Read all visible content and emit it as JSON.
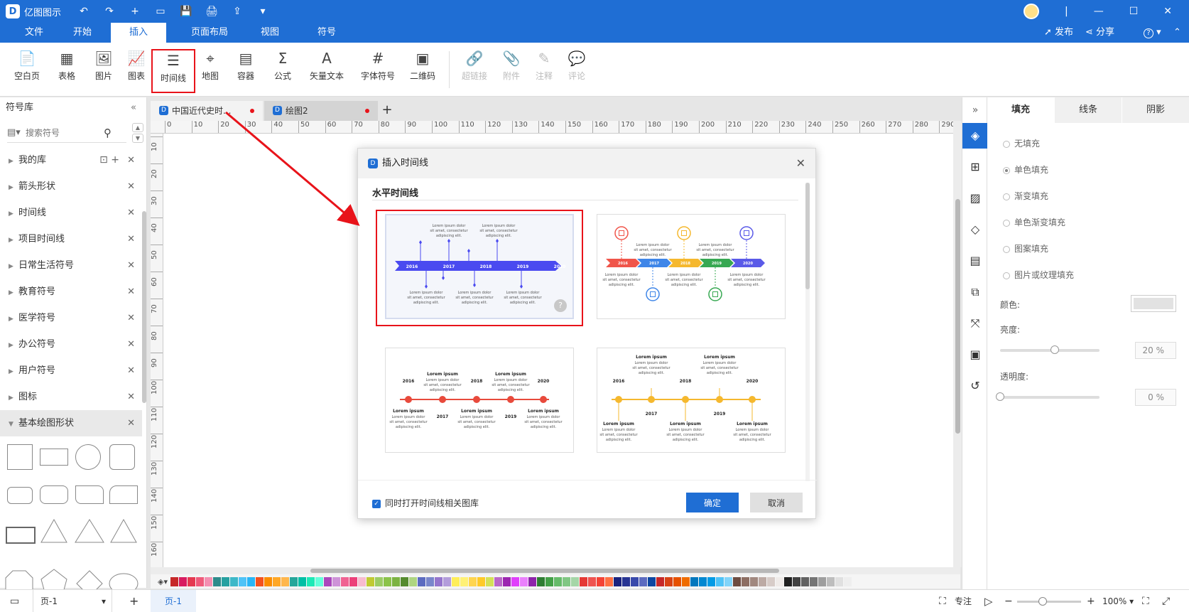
{
  "app": {
    "name": "亿图图示",
    "logo_letter": "D"
  },
  "titlebar": {
    "quick_actions": [
      "↶",
      "↷",
      "+",
      "▭",
      "💾",
      "🖨",
      "⇪",
      "▾"
    ],
    "window_controls": [
      "|",
      "—",
      "☐",
      "✕"
    ]
  },
  "menu": {
    "tabs": [
      "文件",
      "开始",
      "插入",
      "页面布局",
      "视图",
      "符号"
    ],
    "active": "插入",
    "publish": "发布",
    "share": "分享",
    "help": "?"
  },
  "ribbon": {
    "buttons": [
      {
        "label": "空白页",
        "icon": "📄"
      },
      {
        "label": "表格",
        "icon": "▦"
      },
      {
        "label": "图片",
        "icon": "🖼"
      },
      {
        "label": "图表",
        "icon": "📈"
      },
      {
        "label": "时间线",
        "icon": "☰"
      },
      {
        "label": "地图",
        "icon": "⌖"
      },
      {
        "label": "容器",
        "icon": "▤"
      },
      {
        "label": "公式",
        "icon": "Σ"
      },
      {
        "label": "矢量文本",
        "icon": "A"
      },
      {
        "label": "字体符号",
        "icon": "#"
      },
      {
        "label": "二维码",
        "icon": "▣"
      },
      {
        "label": "超链接",
        "icon": "🔗"
      },
      {
        "label": "附件",
        "icon": "📎"
      },
      {
        "label": "注释",
        "icon": "✎"
      },
      {
        "label": "评论",
        "icon": "💬"
      }
    ],
    "highlighted": "时间线"
  },
  "left_panel": {
    "title": "符号库",
    "search_placeholder": "搜索符号",
    "items": [
      {
        "label": "我的库"
      },
      {
        "label": "箭头形状"
      },
      {
        "label": "时间线"
      },
      {
        "label": "项目时间线"
      },
      {
        "label": "日常生活符号"
      },
      {
        "label": "教育符号"
      },
      {
        "label": "医学符号"
      },
      {
        "label": "办公符号"
      },
      {
        "label": "用户符号"
      },
      {
        "label": "图标"
      },
      {
        "label": "基本绘图形状"
      }
    ]
  },
  "doc_tabs": [
    {
      "label": "中国近代史时..."
    },
    {
      "label": "绘图2"
    }
  ],
  "ruler": {
    "h": [
      "0",
      "10",
      "20",
      "30",
      "40",
      "50",
      "60",
      "70",
      "80",
      "90",
      "100",
      "110",
      "120",
      "130",
      "140",
      "150",
      "160",
      "170",
      "180",
      "190",
      "200",
      "210",
      "220",
      "230",
      "240",
      "250",
      "260",
      "270",
      "280",
      "290"
    ],
    "v": [
      "10",
      "20",
      "30",
      "40",
      "50",
      "60",
      "70",
      "80",
      "90",
      "100",
      "110",
      "120",
      "130",
      "140",
      "150",
      "160"
    ]
  },
  "dialog": {
    "title": "插入时间线",
    "section": "水平时间线",
    "checkbox_label": "同时打开时间线相关图库",
    "ok": "确定",
    "cancel": "取消",
    "lorem_title": "Lorem ipsum",
    "lorem_body": [
      "Lorem ipsum dolor",
      "sit amet, consectetur",
      "adipiscing elit."
    ],
    "years": [
      "2016",
      "2017",
      "2018",
      "2019",
      "2020"
    ],
    "help": "?"
  },
  "properties": {
    "tabs": [
      "填充",
      "线条",
      "阴影"
    ],
    "fill_options": [
      "无填充",
      "单色填充",
      "渐变填充",
      "单色渐变填充",
      "图案填充",
      "图片或纹理填充"
    ],
    "selected_fill": "单色填充",
    "color_label": "颜色:",
    "brightness_label": "亮度:",
    "brightness_value": "20 %",
    "brightness_level": 0.55,
    "transparency_label": "透明度:",
    "transparency_value": "0 %",
    "transparency_level": 0.0
  },
  "statusbar": {
    "page_select": "页-1",
    "page_tab": "页-1",
    "focus": "专注",
    "zoom": "100%"
  },
  "colors": {
    "accent": "#1f6ed4",
    "highlight_red": "#e8131a",
    "timeline_blue": "#4a4af0",
    "timeline_red": "#e84a3c",
    "timeline_yellow": "#f5b82e",
    "chev": [
      "#f0554a",
      "#3f86e8",
      "#f5b82e",
      "#37a852",
      "#5a5ae8"
    ],
    "palette": [
      "#c62828",
      "#d81b60",
      "#e53950",
      "#ef5a7a",
      "#f48fb1",
      "#2e8b8b",
      "#26a0a0",
      "#3db8c8",
      "#4fc3f7",
      "#29b6f6",
      "#f4511e",
      "#fb8c00",
      "#ffa726",
      "#ffb74d",
      "#26a69a",
      "#00bfa5",
      "#1de9b6",
      "#64ffda",
      "#ab47bc",
      "#ce93d8",
      "#f06292",
      "#ec407a",
      "#f8bbd0",
      "#c0ca33",
      "#9ccc65",
      "#8bc34a",
      "#7cb342",
      "#558b2f",
      "#aed581",
      "#5c6bc0",
      "#7986cb",
      "#9575cd",
      "#b39ddb",
      "#ffee58",
      "#fff176",
      "#ffd54f",
      "#ffca28",
      "#d4e157",
      "#ba68c8",
      "#9c27b0",
      "#e040fb",
      "#ea80fc",
      "#8e24aa",
      "#2e7d32",
      "#43a047",
      "#66bb6a",
      "#81c784",
      "#a5d6a7",
      "#e53935",
      "#ef5350",
      "#f44336",
      "#ff7043",
      "#1a237e",
      "#283593",
      "#3949ab",
      "#5c6bc0",
      "#0d47a1",
      "#c62828",
      "#d84315",
      "#e65100",
      "#ef6c00",
      "#0277bd",
      "#0288d1",
      "#039be5",
      "#4fc3f7",
      "#81d4fa",
      "#6d4c41",
      "#8d6e63",
      "#a1887f",
      "#bcaaa4",
      "#d7ccc8",
      "#efebe9",
      "#212121",
      "#424242",
      "#616161",
      "#757575",
      "#9e9e9e",
      "#bdbdbd",
      "#e0e0e0",
      "#eeeeee",
      "#f5f5f5"
    ]
  }
}
